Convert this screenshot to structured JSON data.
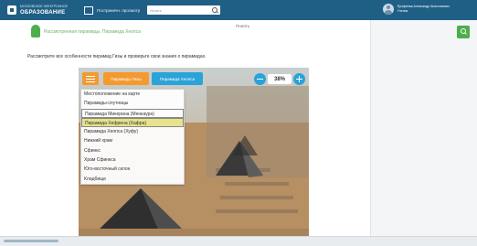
{
  "header": {
    "logo_small": "МОСКОВСКОЕ ЭЛЕКТРОННОЕ",
    "logo_main": "ОБРАЗОВАНИЕ",
    "layout_toggle_label": "Постраничн. просмотр",
    "search_placeholder": "Искать",
    "user_name": "Ерофеева Александр Анатольевич",
    "user_role": "Ученик"
  },
  "lesson": {
    "topic_title": "Рассмотренная пирамиды. Пирамида Хеопса",
    "next_label": "Понять",
    "instruction": "Рассмотрите все особенности пирамид Гизы и проверьте свои знания о пирамидах."
  },
  "viewer": {
    "tabs": [
      {
        "label": "Пирамиды Гизы"
      },
      {
        "label": "Пирамида Хеопса"
      }
    ],
    "zoom_level": "38%",
    "dropdown_items": [
      {
        "label": "Местоположение на карте"
      },
      {
        "label": "Пирамиды-спутницы"
      },
      {
        "label": "Пирамида Микерина (Менкаура)"
      },
      {
        "label": "Пирамида Хефрена (Хафра)"
      },
      {
        "label": "Пирамида Хеопса (Хуфу)"
      },
      {
        "label": "Нижний храм"
      },
      {
        "label": "Сфинкс"
      },
      {
        "label": "Храм Сфинкса"
      },
      {
        "label": "Юго-восточный склон"
      },
      {
        "label": "Кладбище"
      }
    ]
  },
  "colors": {
    "header": "#1f5f86",
    "accent_green": "#4cae4c",
    "tab_orange": "#f39a2f",
    "tab_blue": "#2aa3d8",
    "highlight": "#e6e38a"
  },
  "icons": [
    "logo-icon",
    "layout-icon",
    "search-icon",
    "avatar",
    "topic-icon",
    "side-search-icon",
    "menu-icon",
    "zoom-out-icon",
    "zoom-in-icon"
  ]
}
